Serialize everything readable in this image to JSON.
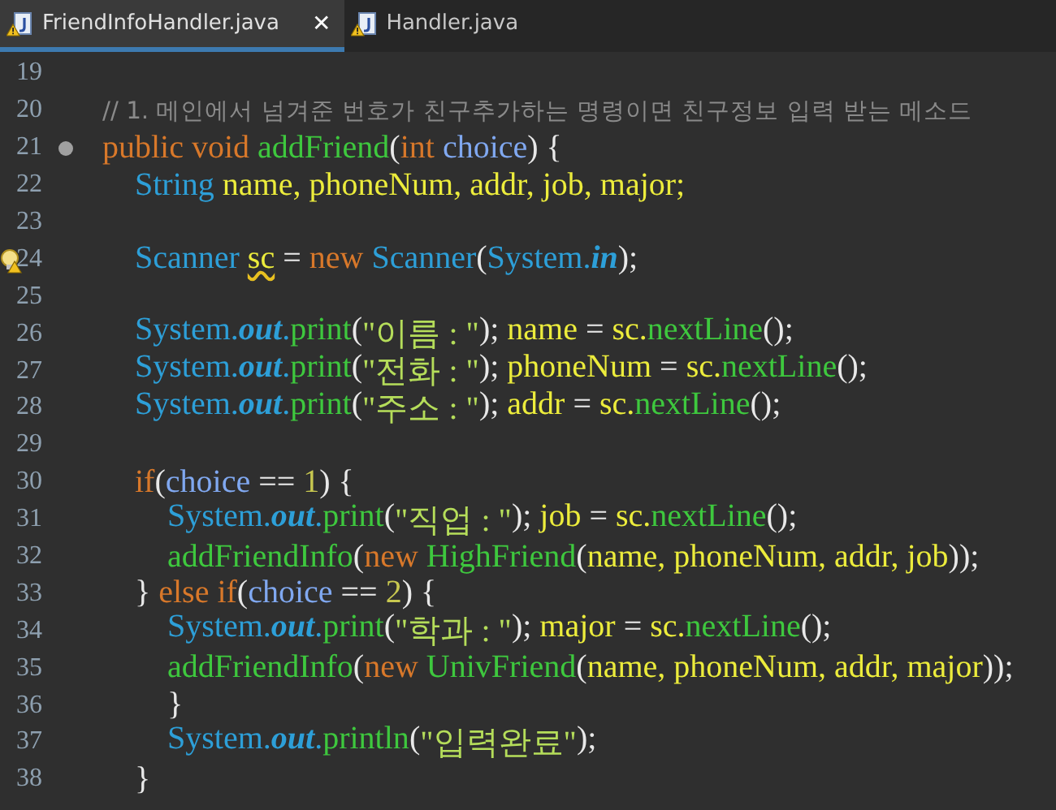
{
  "tabs": [
    {
      "label": "FriendInfoHandler.java",
      "selected": true,
      "close": "✕"
    },
    {
      "label": "Handler.java",
      "selected": false
    }
  ],
  "lines": [
    {
      "number": "19",
      "kind": "plain"
    },
    {
      "number": "20",
      "kind": "plain",
      "tokens": [
        {
          "kind": "comment",
          "t": "// 1. 메인에서 넘겨준 번호가 친구추가하는 명령이면 친구정보 입력 받는 메소드"
        }
      ]
    },
    {
      "number": "21",
      "kind": "fold",
      "tokens": [
        {
          "kind": "keyword",
          "t": "public void "
        },
        {
          "kind": "method",
          "t": "addFriend"
        },
        {
          "kind": "punct",
          "t": "("
        },
        {
          "kind": "keyword",
          "t": "int "
        },
        {
          "kind": "param",
          "t": "choice"
        },
        {
          "kind": "punct",
          "t": ") {"
        }
      ]
    },
    {
      "number": "22",
      "kind": "plain",
      "tokens": [
        {
          "kind": "type",
          "t": "    String "
        },
        {
          "kind": "variable",
          "t": "name, phoneNum, addr, job, major;"
        }
      ]
    },
    {
      "number": "23",
      "kind": "plain"
    },
    {
      "number": "24",
      "kind": "warning",
      "tokens": [
        {
          "kind": "type",
          "t": "    Scanner "
        },
        {
          "kind": "flagged",
          "t": "sc"
        },
        {
          "kind": "punct",
          "t": " = "
        },
        {
          "kind": "keyword",
          "t": "new "
        },
        {
          "kind": "type",
          "t": "Scanner"
        },
        {
          "kind": "punct",
          "t": "("
        },
        {
          "kind": "type",
          "t": "System."
        },
        {
          "kind": "static",
          "t": "in"
        },
        {
          "kind": "punct",
          "t": ");"
        }
      ]
    },
    {
      "number": "25",
      "kind": "plain"
    },
    {
      "number": "26",
      "kind": "plain",
      "tokens": [
        {
          "kind": "type",
          "t": "    System."
        },
        {
          "kind": "static",
          "t": "out"
        },
        {
          "kind": "type",
          "t": "."
        },
        {
          "kind": "method",
          "t": "print"
        },
        {
          "kind": "punct",
          "t": "("
        },
        {
          "kind": "string",
          "t": "\"이름 : \""
        },
        {
          "kind": "punct",
          "t": "); "
        },
        {
          "kind": "variable",
          "t": "name"
        },
        {
          "kind": "punct",
          "t": " = "
        },
        {
          "kind": "variable",
          "t": "sc."
        },
        {
          "kind": "method",
          "t": "nextLine"
        },
        {
          "kind": "punct",
          "t": "();"
        }
      ]
    },
    {
      "number": "27",
      "kind": "plain",
      "tokens": [
        {
          "kind": "type",
          "t": "    System."
        },
        {
          "kind": "static",
          "t": "out"
        },
        {
          "kind": "type",
          "t": "."
        },
        {
          "kind": "method",
          "t": "print"
        },
        {
          "kind": "punct",
          "t": "("
        },
        {
          "kind": "string",
          "t": "\"전화 : \""
        },
        {
          "kind": "punct",
          "t": "); "
        },
        {
          "kind": "variable",
          "t": "phoneNum"
        },
        {
          "kind": "punct",
          "t": " = "
        },
        {
          "kind": "variable",
          "t": "sc."
        },
        {
          "kind": "method",
          "t": "nextLine"
        },
        {
          "kind": "punct",
          "t": "();"
        }
      ]
    },
    {
      "number": "28",
      "kind": "plain",
      "tokens": [
        {
          "kind": "type",
          "t": "    System."
        },
        {
          "kind": "static",
          "t": "out"
        },
        {
          "kind": "type",
          "t": "."
        },
        {
          "kind": "method",
          "t": "print"
        },
        {
          "kind": "punct",
          "t": "("
        },
        {
          "kind": "string",
          "t": "\"주소 : \""
        },
        {
          "kind": "punct",
          "t": "); "
        },
        {
          "kind": "variable",
          "t": "addr"
        },
        {
          "kind": "punct",
          "t": " = "
        },
        {
          "kind": "variable",
          "t": "sc."
        },
        {
          "kind": "method",
          "t": "nextLine"
        },
        {
          "kind": "punct",
          "t": "();"
        }
      ]
    },
    {
      "number": "29",
      "kind": "plain"
    },
    {
      "number": "30",
      "kind": "plain",
      "tokens": [
        {
          "kind": "keyword",
          "t": "    if"
        },
        {
          "kind": "punct",
          "t": "("
        },
        {
          "kind": "param",
          "t": "choice"
        },
        {
          "kind": "punct",
          "t": " == "
        },
        {
          "kind": "number",
          "t": "1"
        },
        {
          "kind": "punct",
          "t": ") {"
        }
      ]
    },
    {
      "number": "31",
      "kind": "plain",
      "tokens": [
        {
          "kind": "type",
          "t": "        System."
        },
        {
          "kind": "static",
          "t": "out"
        },
        {
          "kind": "type",
          "t": "."
        },
        {
          "kind": "method",
          "t": "print"
        },
        {
          "kind": "punct",
          "t": "("
        },
        {
          "kind": "string",
          "t": "\"직업 : \""
        },
        {
          "kind": "punct",
          "t": "); "
        },
        {
          "kind": "variable",
          "t": "job"
        },
        {
          "kind": "punct",
          "t": " = "
        },
        {
          "kind": "variable",
          "t": "sc."
        },
        {
          "kind": "method",
          "t": "nextLine"
        },
        {
          "kind": "punct",
          "t": "();"
        }
      ]
    },
    {
      "number": "32",
      "kind": "plain",
      "tokens": [
        {
          "kind": "method",
          "t": "        addFriendInfo"
        },
        {
          "kind": "punct",
          "t": "("
        },
        {
          "kind": "keyword",
          "t": "new "
        },
        {
          "kind": "method",
          "t": "HighFriend"
        },
        {
          "kind": "punct",
          "t": "("
        },
        {
          "kind": "variable",
          "t": "name, phoneNum, addr, job"
        },
        {
          "kind": "punct",
          "t": "));"
        }
      ]
    },
    {
      "number": "33",
      "kind": "plain",
      "tokens": [
        {
          "kind": "punct",
          "t": "    } "
        },
        {
          "kind": "keyword",
          "t": "else if"
        },
        {
          "kind": "punct",
          "t": "("
        },
        {
          "kind": "param",
          "t": "choice"
        },
        {
          "kind": "punct",
          "t": " == "
        },
        {
          "kind": "number",
          "t": "2"
        },
        {
          "kind": "punct",
          "t": ") {"
        }
      ]
    },
    {
      "number": "34",
      "kind": "plain",
      "tokens": [
        {
          "kind": "type",
          "t": "        System."
        },
        {
          "kind": "static",
          "t": "out"
        },
        {
          "kind": "type",
          "t": "."
        },
        {
          "kind": "method",
          "t": "print"
        },
        {
          "kind": "punct",
          "t": "("
        },
        {
          "kind": "string",
          "t": "\"학과 : \""
        },
        {
          "kind": "punct",
          "t": "); "
        },
        {
          "kind": "variable",
          "t": "major"
        },
        {
          "kind": "punct",
          "t": " = "
        },
        {
          "kind": "variable",
          "t": "sc."
        },
        {
          "kind": "method",
          "t": "nextLine"
        },
        {
          "kind": "punct",
          "t": "();"
        }
      ]
    },
    {
      "number": "35",
      "kind": "plain",
      "tokens": [
        {
          "kind": "method",
          "t": "        addFriendInfo"
        },
        {
          "kind": "punct",
          "t": "("
        },
        {
          "kind": "keyword",
          "t": "new "
        },
        {
          "kind": "method",
          "t": "UnivFriend"
        },
        {
          "kind": "punct",
          "t": "("
        },
        {
          "kind": "variable",
          "t": "name, phoneNum, addr, major"
        },
        {
          "kind": "punct",
          "t": "));"
        }
      ]
    },
    {
      "number": "36",
      "kind": "plain",
      "tokens": [
        {
          "kind": "punct",
          "t": "        }"
        }
      ]
    },
    {
      "number": "37",
      "kind": "plain",
      "tokens": [
        {
          "kind": "type",
          "t": "        System."
        },
        {
          "kind": "static",
          "t": "out"
        },
        {
          "kind": "type",
          "t": "."
        },
        {
          "kind": "method",
          "t": "println"
        },
        {
          "kind": "punct",
          "t": "("
        },
        {
          "kind": "string",
          "t": "\"입력완료\""
        },
        {
          "kind": "punct",
          "t": ");"
        }
      ]
    },
    {
      "number": "38",
      "kind": "plain",
      "tokens": [
        {
          "kind": "punct",
          "t": "    }"
        }
      ]
    }
  ]
}
